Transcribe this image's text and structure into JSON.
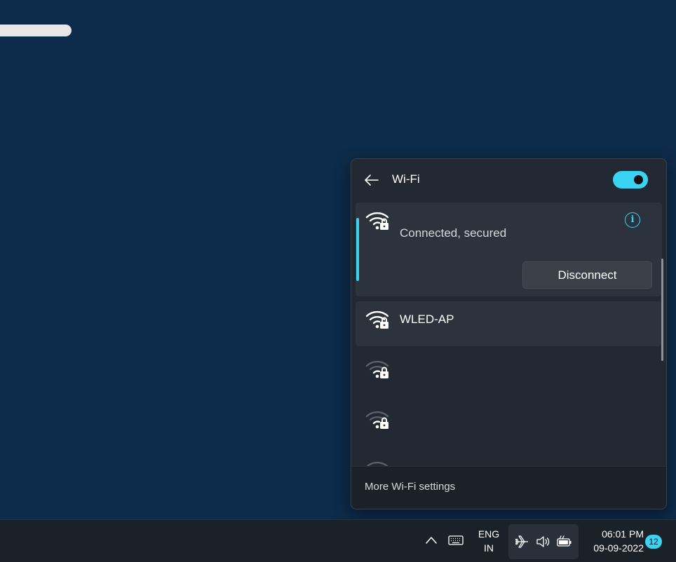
{
  "wifi_panel": {
    "title": "Wi-Fi",
    "toggle_on": true,
    "connected_network": {
      "status": "Connected, secured",
      "disconnect_label": "Disconnect"
    },
    "networks": [
      {
        "name": "WLED-AP"
      },
      {
        "name": ""
      },
      {
        "name": ""
      }
    ],
    "footer_link": "More Wi-Fi settings"
  },
  "taskbar": {
    "language_line1": "ENG",
    "language_line2": "IN",
    "time": "06:01 PM",
    "date": "09-09-2022",
    "notification_count": "12"
  },
  "colors": {
    "accent": "#3ad3f2",
    "desktop": "#0d2b4a",
    "panel": "#222933"
  }
}
